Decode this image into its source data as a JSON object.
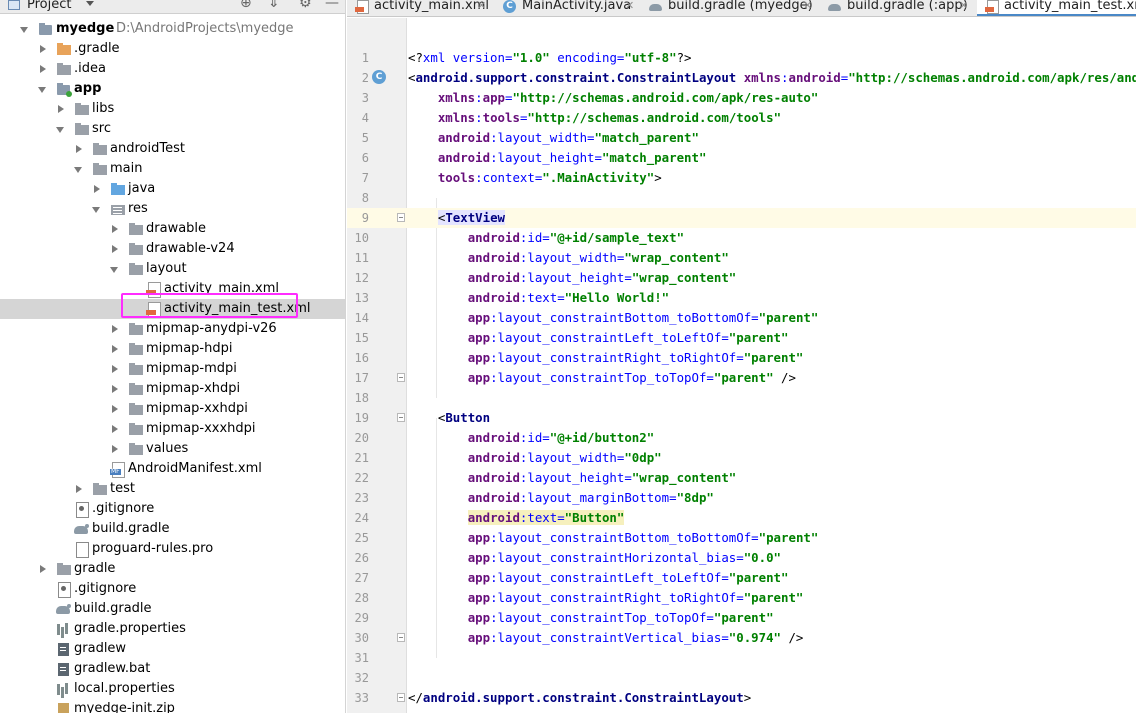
{
  "project_panel": {
    "title": "Project",
    "tree": [
      {
        "depth": 0,
        "arrow": "down",
        "icon": "module-icon",
        "label": "myedge",
        "bold": true,
        "path": "D:\\AndroidProjects\\myedge"
      },
      {
        "depth": 1,
        "arrow": "right",
        "icon": "folder-orange-icon",
        "label": ".gradle"
      },
      {
        "depth": 1,
        "arrow": "right",
        "icon": "folder-icon",
        "label": ".idea"
      },
      {
        "depth": 1,
        "arrow": "down",
        "icon": "app-module-icon",
        "label": "app",
        "bold": true
      },
      {
        "depth": 2,
        "arrow": "right",
        "icon": "folder-icon",
        "label": "libs"
      },
      {
        "depth": 2,
        "arrow": "down",
        "icon": "folder-icon",
        "label": "src"
      },
      {
        "depth": 3,
        "arrow": "right",
        "icon": "folder-icon",
        "label": "androidTest"
      },
      {
        "depth": 3,
        "arrow": "down",
        "icon": "folder-icon",
        "label": "main"
      },
      {
        "depth": 4,
        "arrow": "right",
        "icon": "folder-blue-icon",
        "label": "java"
      },
      {
        "depth": 4,
        "arrow": "down",
        "icon": "res-folder-icon",
        "label": "res"
      },
      {
        "depth": 5,
        "arrow": "right",
        "icon": "folder-icon",
        "label": "drawable"
      },
      {
        "depth": 5,
        "arrow": "right",
        "icon": "folder-icon",
        "label": "drawable-v24"
      },
      {
        "depth": 5,
        "arrow": "down",
        "icon": "folder-icon",
        "label": "layout"
      },
      {
        "depth": 6,
        "arrow": "none",
        "icon": "xml-file-icon",
        "label": "activity_main.xml"
      },
      {
        "depth": 6,
        "arrow": "none",
        "icon": "xml-file-icon",
        "label": "activity_main_test.xml",
        "selected": true
      },
      {
        "depth": 5,
        "arrow": "right",
        "icon": "folder-icon",
        "label": "mipmap-anydpi-v26"
      },
      {
        "depth": 5,
        "arrow": "right",
        "icon": "folder-icon",
        "label": "mipmap-hdpi"
      },
      {
        "depth": 5,
        "arrow": "right",
        "icon": "folder-icon",
        "label": "mipmap-mdpi"
      },
      {
        "depth": 5,
        "arrow": "right",
        "icon": "folder-icon",
        "label": "mipmap-xhdpi"
      },
      {
        "depth": 5,
        "arrow": "right",
        "icon": "folder-icon",
        "label": "mipmap-xxhdpi"
      },
      {
        "depth": 5,
        "arrow": "right",
        "icon": "folder-icon",
        "label": "mipmap-xxxhdpi"
      },
      {
        "depth": 5,
        "arrow": "right",
        "icon": "folder-icon",
        "label": "values"
      },
      {
        "depth": 4,
        "arrow": "none",
        "icon": "manifest-file-icon",
        "label": "AndroidManifest.xml"
      },
      {
        "depth": 3,
        "arrow": "right",
        "icon": "folder-icon",
        "label": "test"
      },
      {
        "depth": 2,
        "arrow": "none",
        "icon": "gitignore-file-icon",
        "label": ".gitignore"
      },
      {
        "depth": 2,
        "arrow": "none",
        "icon": "gradle-file-icon",
        "label": "build.gradle"
      },
      {
        "depth": 2,
        "arrow": "none",
        "icon": "text-file-icon",
        "label": "proguard-rules.pro"
      },
      {
        "depth": 1,
        "arrow": "right",
        "icon": "folder-icon",
        "label": "gradle"
      },
      {
        "depth": 1,
        "arrow": "none",
        "icon": "gitignore-file-icon",
        "label": ".gitignore"
      },
      {
        "depth": 1,
        "arrow": "none",
        "icon": "gradle-file-icon",
        "label": "build.gradle"
      },
      {
        "depth": 1,
        "arrow": "none",
        "icon": "properties-file-icon",
        "label": "gradle.properties"
      },
      {
        "depth": 1,
        "arrow": "none",
        "icon": "script-file-icon",
        "label": "gradlew"
      },
      {
        "depth": 1,
        "arrow": "none",
        "icon": "script-file-icon",
        "label": "gradlew.bat"
      },
      {
        "depth": 1,
        "arrow": "none",
        "icon": "properties-file-icon",
        "label": "local.properties"
      },
      {
        "depth": 1,
        "arrow": "none",
        "icon": "zip-file-icon",
        "label": "myedge-init.zip"
      }
    ]
  },
  "tabs": [
    {
      "label": "activity_main.xml",
      "icon": "xml-file-icon",
      "active": false
    },
    {
      "label": "MainActivity.java",
      "icon": "java-class-icon",
      "active": false
    },
    {
      "label": "build.gradle (myedge)",
      "icon": "gradle-file-icon",
      "active": false
    },
    {
      "label": "build.gradle (:app)",
      "icon": "gradle-file-icon",
      "active": false
    },
    {
      "label": "activity_main_test.xml",
      "icon": "xml-file-icon",
      "active": true
    }
  ],
  "editor": {
    "lines": [
      {
        "n": "1",
        "tokens": [
          [
            "punc",
            "<?"
          ],
          [
            "xmldecl",
            "xml version="
          ],
          [
            "val",
            "\"1.0\""
          ],
          [
            "xmldecl",
            " encoding="
          ],
          [
            "val",
            "\"utf-8\""
          ],
          [
            "punc",
            "?>"
          ]
        ]
      },
      {
        "n": "2",
        "gutter_icon": "class-marker-icon",
        "tokens": [
          [
            "punc",
            "<"
          ],
          [
            "tag",
            "android.support.constraint.ConstraintLayout"
          ],
          [
            "punc",
            " "
          ],
          [
            "ns",
            "xmlns"
          ],
          [
            "attr",
            ":"
          ],
          [
            "ns",
            "android"
          ],
          [
            "attr",
            "="
          ],
          [
            "val",
            "\"http://schemas.android.com/apk/res/android\""
          ]
        ]
      },
      {
        "n": "3",
        "tokens": [
          [
            "punc",
            "    "
          ],
          [
            "ns",
            "xmlns"
          ],
          [
            "attr",
            ":"
          ],
          [
            "ns",
            "app"
          ],
          [
            "attr",
            "="
          ],
          [
            "val",
            "\"http://schemas.android.com/apk/res-auto\""
          ]
        ]
      },
      {
        "n": "4",
        "tokens": [
          [
            "punc",
            "    "
          ],
          [
            "ns",
            "xmlns"
          ],
          [
            "attr",
            ":"
          ],
          [
            "ns",
            "tools"
          ],
          [
            "attr",
            "="
          ],
          [
            "val",
            "\"http://schemas.android.com/tools\""
          ]
        ]
      },
      {
        "n": "5",
        "tokens": [
          [
            "punc",
            "    "
          ],
          [
            "ns",
            "android"
          ],
          [
            "attr",
            ":layout_width="
          ],
          [
            "val",
            "\"match_parent\""
          ]
        ]
      },
      {
        "n": "6",
        "tokens": [
          [
            "punc",
            "    "
          ],
          [
            "ns",
            "android"
          ],
          [
            "attr",
            ":layout_height="
          ],
          [
            "val",
            "\"match_parent\""
          ]
        ]
      },
      {
        "n": "7",
        "tokens": [
          [
            "punc",
            "    "
          ],
          [
            "ns",
            "tools"
          ],
          [
            "attr",
            ":context="
          ],
          [
            "val",
            "\".MainActivity\""
          ],
          [
            "punc",
            ">"
          ]
        ]
      },
      {
        "n": "8",
        "tokens": []
      },
      {
        "n": "9",
        "current": true,
        "fold": true,
        "tokens": [
          [
            "punc",
            "    "
          ],
          [
            "taghl",
            "<"
          ],
          [
            "taghlb",
            "TextView"
          ]
        ]
      },
      {
        "n": "10",
        "tokens": [
          [
            "punc",
            "        "
          ],
          [
            "ns",
            "android"
          ],
          [
            "attr",
            ":id="
          ],
          [
            "val",
            "\"@+id/sample_text\""
          ]
        ]
      },
      {
        "n": "11",
        "tokens": [
          [
            "punc",
            "        "
          ],
          [
            "ns",
            "android"
          ],
          [
            "attr",
            ":layout_width="
          ],
          [
            "val",
            "\"wrap_content\""
          ]
        ]
      },
      {
        "n": "12",
        "tokens": [
          [
            "punc",
            "        "
          ],
          [
            "ns",
            "android"
          ],
          [
            "attr",
            ":layout_height="
          ],
          [
            "val",
            "\"wrap_content\""
          ]
        ]
      },
      {
        "n": "13",
        "tokens": [
          [
            "punc",
            "        "
          ],
          [
            "ns",
            "android"
          ],
          [
            "attr",
            ":text="
          ],
          [
            "val",
            "\"Hello World!\""
          ]
        ]
      },
      {
        "n": "14",
        "tokens": [
          [
            "punc",
            "        "
          ],
          [
            "ns",
            "app"
          ],
          [
            "attr",
            ":layout_constraintBottom_toBottomOf="
          ],
          [
            "val",
            "\"parent\""
          ]
        ]
      },
      {
        "n": "15",
        "tokens": [
          [
            "punc",
            "        "
          ],
          [
            "ns",
            "app"
          ],
          [
            "attr",
            ":layout_constraintLeft_toLeftOf="
          ],
          [
            "val",
            "\"parent\""
          ]
        ]
      },
      {
        "n": "16",
        "tokens": [
          [
            "punc",
            "        "
          ],
          [
            "ns",
            "app"
          ],
          [
            "attr",
            ":layout_constraintRight_toRightOf="
          ],
          [
            "val",
            "\"parent\""
          ]
        ]
      },
      {
        "n": "17",
        "fold": true,
        "tokens": [
          [
            "punc",
            "        "
          ],
          [
            "ns",
            "app"
          ],
          [
            "attr",
            ":layout_constraintTop_toTopOf="
          ],
          [
            "val",
            "\"parent\""
          ],
          [
            "punc",
            " />"
          ]
        ]
      },
      {
        "n": "18",
        "tokens": []
      },
      {
        "n": "19",
        "fold": true,
        "tokens": [
          [
            "punc",
            "    <"
          ],
          [
            "tag",
            "Button"
          ]
        ]
      },
      {
        "n": "20",
        "tokens": [
          [
            "punc",
            "        "
          ],
          [
            "ns",
            "android"
          ],
          [
            "attr",
            ":id="
          ],
          [
            "val",
            "\"@+id/button2\""
          ]
        ]
      },
      {
        "n": "21",
        "tokens": [
          [
            "punc",
            "        "
          ],
          [
            "ns",
            "android"
          ],
          [
            "attr",
            ":layout_width="
          ],
          [
            "val",
            "\"0dp\""
          ]
        ]
      },
      {
        "n": "22",
        "tokens": [
          [
            "punc",
            "        "
          ],
          [
            "ns",
            "android"
          ],
          [
            "attr",
            ":layout_height="
          ],
          [
            "val",
            "\"wrap_content\""
          ]
        ]
      },
      {
        "n": "23",
        "tokens": [
          [
            "punc",
            "        "
          ],
          [
            "ns",
            "android"
          ],
          [
            "attr",
            ":layout_marginBottom="
          ],
          [
            "val",
            "\"8dp\""
          ]
        ]
      },
      {
        "n": "24",
        "tokens": [
          [
            "punc",
            "        "
          ],
          [
            "nshl",
            "android"
          ],
          [
            "attrhl",
            ":text="
          ],
          [
            "valhl",
            "\"Button\""
          ]
        ]
      },
      {
        "n": "25",
        "tokens": [
          [
            "punc",
            "        "
          ],
          [
            "ns",
            "app"
          ],
          [
            "attr",
            ":layout_constraintBottom_toBottomOf="
          ],
          [
            "val",
            "\"parent\""
          ]
        ]
      },
      {
        "n": "26",
        "tokens": [
          [
            "punc",
            "        "
          ],
          [
            "ns",
            "app"
          ],
          [
            "attr",
            ":layout_constraintHorizontal_bias="
          ],
          [
            "val",
            "\"0.0\""
          ]
        ]
      },
      {
        "n": "27",
        "tokens": [
          [
            "punc",
            "        "
          ],
          [
            "ns",
            "app"
          ],
          [
            "attr",
            ":layout_constraintLeft_toLeftOf="
          ],
          [
            "val",
            "\"parent\""
          ]
        ]
      },
      {
        "n": "28",
        "tokens": [
          [
            "punc",
            "        "
          ],
          [
            "ns",
            "app"
          ],
          [
            "attr",
            ":layout_constraintRight_toRightOf="
          ],
          [
            "val",
            "\"parent\""
          ]
        ]
      },
      {
        "n": "29",
        "tokens": [
          [
            "punc",
            "        "
          ],
          [
            "ns",
            "app"
          ],
          [
            "attr",
            ":layout_constraintTop_toTopOf="
          ],
          [
            "val",
            "\"parent\""
          ]
        ]
      },
      {
        "n": "30",
        "fold": true,
        "tokens": [
          [
            "punc",
            "        "
          ],
          [
            "ns",
            "app"
          ],
          [
            "attr",
            ":layout_constraintVertical_bias="
          ],
          [
            "val",
            "\"0.974\""
          ],
          [
            "punc",
            " />"
          ]
        ]
      },
      {
        "n": "31",
        "tokens": []
      },
      {
        "n": "32",
        "tokens": []
      },
      {
        "n": "33",
        "fold": true,
        "tokens": [
          [
            "punc",
            "</"
          ],
          [
            "tag",
            "android.support.constraint.ConstraintLayout"
          ],
          [
            "punc",
            ">"
          ]
        ]
      }
    ]
  },
  "colors": {
    "selection_outline": "#ff2cff",
    "active_tab_accent": "#4a88c7"
  }
}
